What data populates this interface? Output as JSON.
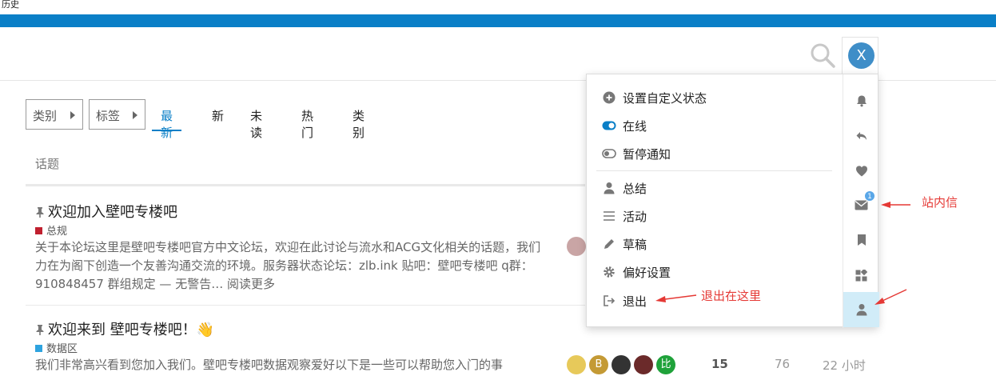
{
  "window": {
    "title": "历史"
  },
  "header": {
    "avatar_letter": "X"
  },
  "nav": {
    "filters": [
      {
        "label": "类别"
      },
      {
        "label": "标签"
      }
    ],
    "tabs": [
      {
        "label": "最新",
        "active": true
      },
      {
        "label": "新"
      },
      {
        "label": "未读"
      },
      {
        "label": "热门"
      },
      {
        "label": "类别"
      }
    ]
  },
  "list": {
    "header": "话题",
    "topics": [
      {
        "title": "欢迎加入壁吧专楼吧",
        "category": "总规",
        "category_color": "#c0202f",
        "excerpt": "关于本论坛这里是壁吧专楼吧官方中文论坛，欢迎在此讨论与流水和ACG文化相关的话题，我们力在为阁下创造一个友善沟通交流的环境。服务器状态论坛：zlb.ink 贴吧：壁吧专楼吧 q群：910848457 群组规定 — 无警告… 阅读更多"
      },
      {
        "title": "欢迎来到 壁吧专楼吧！👋",
        "category": "数据区",
        "category_color": "#2ea3df",
        "excerpt": "我们非常高兴看到您加入我们。壁吧专楼吧数据观察爱好以下是一些可以帮助您入门的事",
        "replies": "15",
        "views": "76",
        "activity": "22 小时",
        "posters": [
          {
            "label": "",
            "color": "#e7c95a"
          },
          {
            "label": "B",
            "color": "#c49a35"
          },
          {
            "label": "",
            "color": "#333333"
          },
          {
            "label": "",
            "color": "#6b2a2a"
          },
          {
            "label": "比",
            "color": "#1fa23a"
          }
        ]
      }
    ]
  },
  "user_menu": {
    "items": [
      {
        "label": "设置自定义状态",
        "icon": "plus-circle-icon"
      },
      {
        "label": "在线",
        "icon": "toggle-on-icon"
      },
      {
        "label": "暂停通知",
        "icon": "toggle-off-icon"
      },
      {
        "label": "总结",
        "icon": "user-icon"
      },
      {
        "label": "活动",
        "icon": "list-icon"
      },
      {
        "label": "草稿",
        "icon": "pencil-icon"
      },
      {
        "label": "偏好设置",
        "icon": "gear-icon"
      },
      {
        "label": "退出",
        "icon": "sign-out-icon"
      }
    ],
    "side_tabs": [
      {
        "icon": "bell-icon"
      },
      {
        "icon": "reply-icon"
      },
      {
        "icon": "heart-icon"
      },
      {
        "icon": "envelope-icon",
        "badge": "1"
      },
      {
        "icon": "bookmark-icon"
      },
      {
        "icon": "widgets-icon"
      },
      {
        "icon": "user-icon",
        "active": true
      }
    ]
  },
  "annotations": {
    "messages_note": "站内信",
    "logout_note": "退出在这里",
    "color": "#e53935"
  }
}
